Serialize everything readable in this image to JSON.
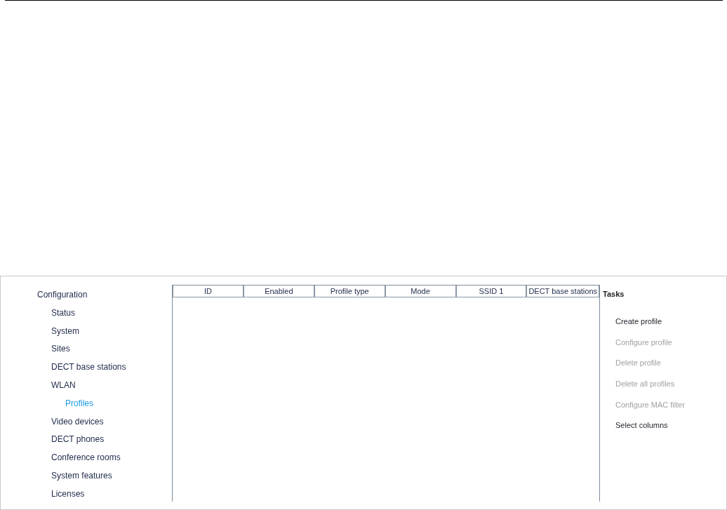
{
  "navigation": {
    "items": [
      {
        "label": "Configuration",
        "selected": false,
        "children": [
          {
            "label": "Status",
            "selected": false
          },
          {
            "label": "System",
            "selected": false
          },
          {
            "label": "Sites",
            "selected": false
          },
          {
            "label": "DECT base stations",
            "selected": false
          },
          {
            "label": "WLAN",
            "selected": false,
            "children": [
              {
                "label": "Profiles",
                "selected": true
              }
            ]
          },
          {
            "label": "Video devices",
            "selected": false
          },
          {
            "label": "DECT phones",
            "selected": false
          },
          {
            "label": "Conference rooms",
            "selected": false
          },
          {
            "label": "System features",
            "selected": false
          },
          {
            "label": "Licenses",
            "selected": false
          }
        ]
      }
    ]
  },
  "table": {
    "columns": [
      "ID",
      "Enabled",
      "Profile type",
      "Mode",
      "SSID 1",
      "DECT base stations"
    ]
  },
  "tasks": {
    "title": "Tasks",
    "items": [
      {
        "label": "Create profile",
        "disabled": false
      },
      {
        "label": "Configure profile",
        "disabled": true
      },
      {
        "label": "Delete profile",
        "disabled": true
      },
      {
        "label": "Delete all profiles",
        "disabled": true
      },
      {
        "label": "Configure MAC filter",
        "disabled": true
      },
      {
        "label": "Select columns",
        "disabled": false
      }
    ]
  }
}
